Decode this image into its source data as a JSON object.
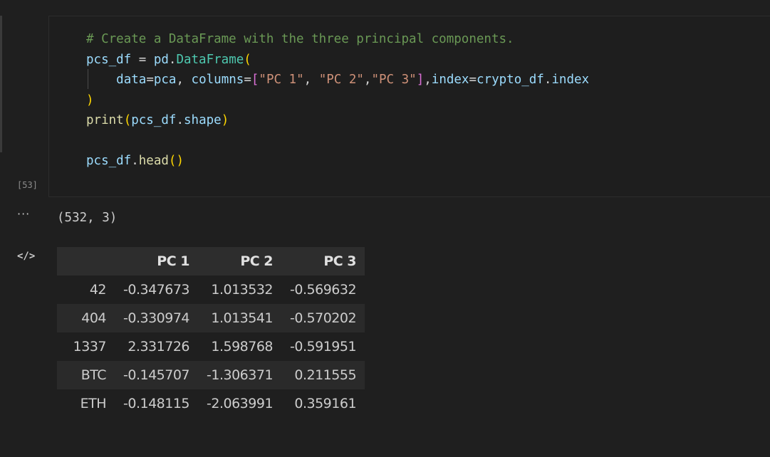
{
  "cell": {
    "execution_count": "[53]",
    "code_lines": [
      [
        {
          "t": "# Create a DataFrame with the three principal components.",
          "c": "cm"
        }
      ],
      [
        {
          "t": "pcs_df",
          "c": "vr"
        },
        {
          "t": " = ",
          "c": "op"
        },
        {
          "t": "pd",
          "c": "vr"
        },
        {
          "t": ".",
          "c": "op"
        },
        {
          "t": "DataFrame",
          "c": "cl"
        },
        {
          "t": "(",
          "c": "b1"
        }
      ],
      [
        {
          "t": "    ",
          "c": "op"
        },
        {
          "t": "data",
          "c": "pr"
        },
        {
          "t": "=",
          "c": "op"
        },
        {
          "t": "pca",
          "c": "vr"
        },
        {
          "t": ", ",
          "c": "op"
        },
        {
          "t": "columns",
          "c": "pr"
        },
        {
          "t": "=",
          "c": "op"
        },
        {
          "t": "[",
          "c": "b2"
        },
        {
          "t": "\"PC 1\"",
          "c": "st"
        },
        {
          "t": ", ",
          "c": "op"
        },
        {
          "t": "\"PC 2\"",
          "c": "st"
        },
        {
          "t": ",",
          "c": "op"
        },
        {
          "t": "\"PC 3\"",
          "c": "st"
        },
        {
          "t": "]",
          "c": "b2"
        },
        {
          "t": ",",
          "c": "op"
        },
        {
          "t": "index",
          "c": "pr"
        },
        {
          "t": "=",
          "c": "op"
        },
        {
          "t": "crypto_df",
          "c": "vr"
        },
        {
          "t": ".",
          "c": "op"
        },
        {
          "t": "index",
          "c": "vr"
        }
      ],
      [
        {
          "t": ")",
          "c": "b1"
        }
      ],
      [
        {
          "t": "print",
          "c": "fn"
        },
        {
          "t": "(",
          "c": "b1"
        },
        {
          "t": "pcs_df",
          "c": "vr"
        },
        {
          "t": ".",
          "c": "op"
        },
        {
          "t": "shape",
          "c": "vr"
        },
        {
          "t": ")",
          "c": "b1"
        }
      ],
      [
        {
          "t": "",
          "c": "op"
        }
      ],
      [
        {
          "t": "pcs_df",
          "c": "vr"
        },
        {
          "t": ".",
          "c": "op"
        },
        {
          "t": "head",
          "c": "fn"
        },
        {
          "t": "()",
          "c": "b1"
        }
      ]
    ]
  },
  "output": {
    "stdout": "(532, 3)",
    "ellipsis_label": "···",
    "code_icon_label": "</>",
    "table": {
      "columns": [
        "",
        "PC 1",
        "PC 2",
        "PC 3"
      ],
      "rows": [
        [
          "42",
          "-0.347673",
          "1.013532",
          "-0.569632"
        ],
        [
          "404",
          "-0.330974",
          "1.013541",
          "-0.570202"
        ],
        [
          "1337",
          "2.331726",
          "1.598768",
          "-0.591951"
        ],
        [
          "BTC",
          "-0.145707",
          "-1.306371",
          "0.211555"
        ],
        [
          "ETH",
          "-0.148115",
          "-2.063991",
          "0.359161"
        ]
      ]
    }
  }
}
